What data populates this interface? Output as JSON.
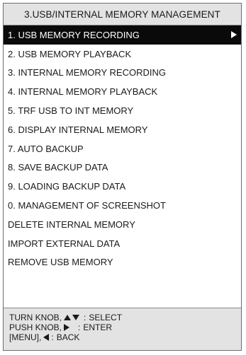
{
  "title": "3.USB/INTERNAL MEMORY MANAGEMENT",
  "menu": {
    "items": [
      {
        "label": "1. USB MEMORY RECORDING",
        "selected": true
      },
      {
        "label": "2. USB MEMORY PLAYBACK"
      },
      {
        "label": "3. INTERNAL MEMORY RECORDING"
      },
      {
        "label": "4. INTERNAL MEMORY PLAYBACK"
      },
      {
        "label": "5. TRF USB TO INT MEMORY"
      },
      {
        "label": "6. DISPLAY INTERNAL MEMORY"
      },
      {
        "label": "7. AUTO BACKUP"
      },
      {
        "label": "8. SAVE BACKUP DATA"
      },
      {
        "label": "9. LOADING BACKUP DATA"
      },
      {
        "label": "0. MANAGEMENT OF SCREENSHOT"
      },
      {
        "label": "DELETE INTERNAL MEMORY"
      },
      {
        "label": "IMPORT EXTERNAL DATA"
      },
      {
        "label": "REMOVE USB MEMORY"
      }
    ]
  },
  "help": {
    "line1_prefix": "TURN KNOB,",
    "line1_action": "SELECT",
    "line2_prefix": "PUSH KNOB,",
    "line2_action": "ENTER",
    "line3_prefix": "[MENU],",
    "line3_action": "BACK",
    "colon": ":"
  },
  "colors": {
    "selected_bg": "#0a0a0a",
    "selected_fg": "#ffffff",
    "header_bg": "#e3e3e3"
  }
}
